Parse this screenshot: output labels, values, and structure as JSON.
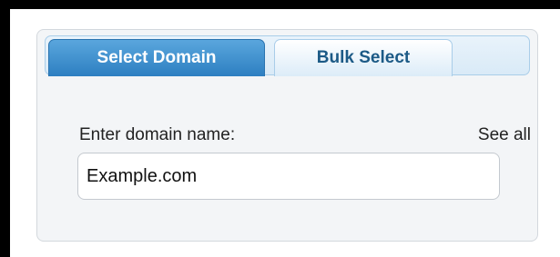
{
  "tabs": {
    "select_domain": "Select Domain",
    "bulk_select": "Bulk Select"
  },
  "form": {
    "label": "Enter domain name:",
    "see_all": "See all",
    "domain_value": "Example.com"
  },
  "colors": {
    "active_tab": "#2d7fc1",
    "inactive_tab_text": "#1c5a86",
    "panel_bg": "#f3f5f7"
  }
}
